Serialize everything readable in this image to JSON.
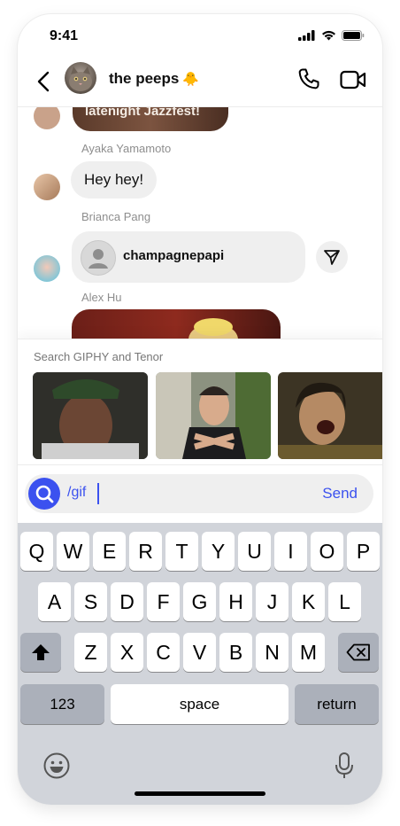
{
  "status": {
    "time": "9:41"
  },
  "header": {
    "title": "the peeps",
    "title_emoji": "🐥"
  },
  "chat": {
    "top_bubble_text": "latenight Jazzfest!",
    "messages": [
      {
        "sender": "Ayaka Yamamoto",
        "text": "Hey hey!"
      },
      {
        "sender": "Brianca Pang",
        "shared_profile": "champagnepapi"
      },
      {
        "sender": "Alex Hu"
      }
    ]
  },
  "gif_panel": {
    "title": "Search GIPHY and Tenor"
  },
  "composer": {
    "value": "/gif",
    "send_label": "Send"
  },
  "keyboard": {
    "row1": [
      "Q",
      "W",
      "E",
      "R",
      "T",
      "Y",
      "U",
      "I",
      "O",
      "P"
    ],
    "row2": [
      "A",
      "S",
      "D",
      "F",
      "G",
      "H",
      "J",
      "K",
      "L"
    ],
    "row3": [
      "Z",
      "X",
      "C",
      "V",
      "B",
      "N",
      "M"
    ],
    "numbers": "123",
    "space": "space",
    "return": "return"
  },
  "colors": {
    "accent": "#3b51ef",
    "bubble": "#efefef",
    "keyboard_bg": "#d1d4da"
  }
}
